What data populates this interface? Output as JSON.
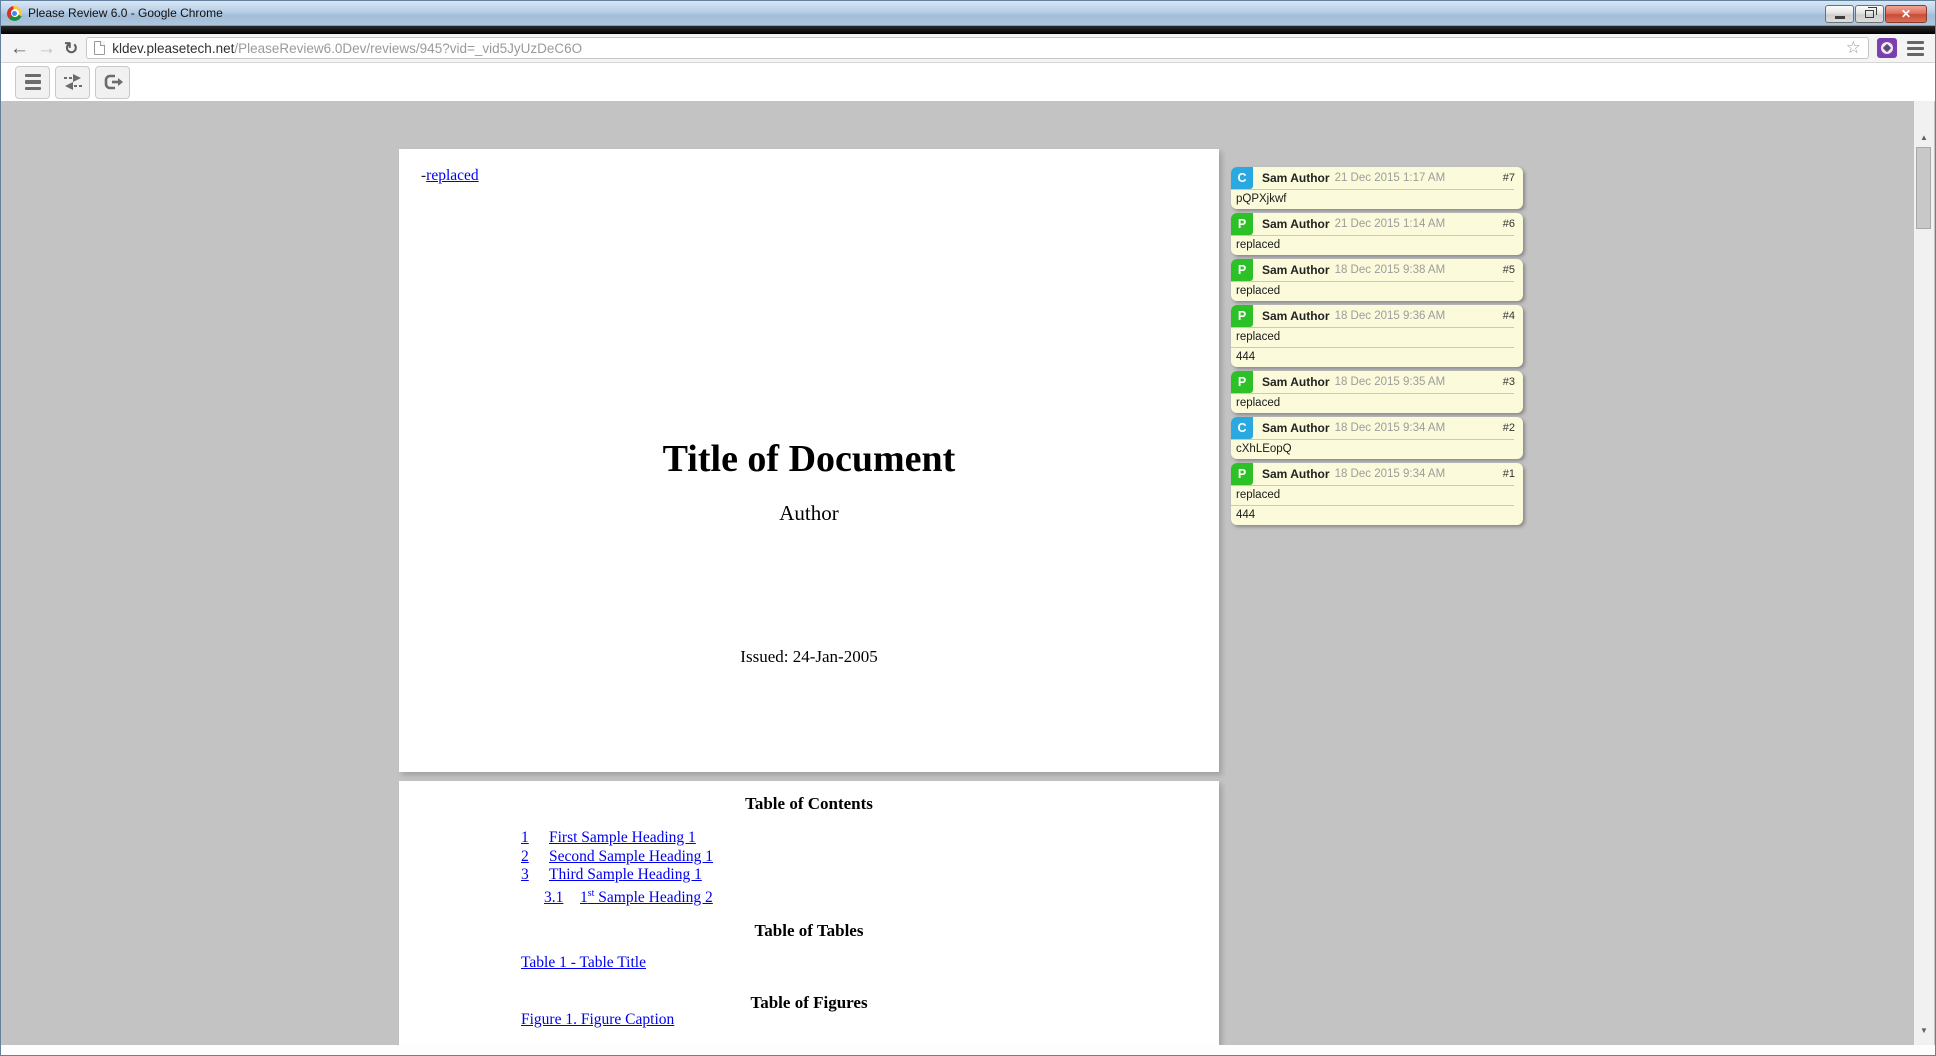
{
  "window": {
    "title": "Please Review 6.0 - Google Chrome",
    "close_glyph": "✕"
  },
  "browser": {
    "back_glyph": "←",
    "forward_glyph": "→",
    "reload_glyph": "↻",
    "star_glyph": "☆",
    "url_host": "kldev.pleasetech.net",
    "url_rest": "/PleaseReview6.0Dev/reviews/945?vid=_vid5JyUzDeC6O"
  },
  "scrollbar": {
    "up_glyph": "▲",
    "down_glyph": "▼"
  },
  "document": {
    "page1": {
      "change_prefix": "-",
      "change_link": "replaced",
      "title": "Title of Document",
      "author": "Author",
      "issued": "Issued: 24-Jan-2005"
    },
    "page2": {
      "toc_heading": "Table of Contents",
      "toc_entries": [
        {
          "num": "1",
          "label": "First Sample Heading 1",
          "sub": false
        },
        {
          "num": "2",
          "label": "Second Sample Heading 1",
          "sub": false
        },
        {
          "num": "3",
          "label": "Third Sample Heading 1",
          "sub": false
        },
        {
          "num": "3.1",
          "pre": "1",
          "sup": "st",
          "post": " Sample Heading 2",
          "sub": true
        }
      ],
      "tables_heading": "Table of Tables",
      "tables_entry": "Table 1 - Table Title",
      "figures_heading": "Table of Figures",
      "figures_entry": "Figure 1. Figure Caption"
    }
  },
  "comments": [
    {
      "type": "C",
      "author": "Sam Author",
      "time": "21 Dec 2015 1:17 AM",
      "num": "#7",
      "lines": [
        "pQPXjkwf"
      ]
    },
    {
      "type": "P",
      "author": "Sam Author",
      "time": "21 Dec 2015 1:14 AM",
      "num": "#6",
      "lines": [
        "replaced"
      ]
    },
    {
      "type": "P",
      "author": "Sam Author",
      "time": "18 Dec 2015 9:38 AM",
      "num": "#5",
      "lines": [
        "replaced"
      ]
    },
    {
      "type": "P",
      "author": "Sam Author",
      "time": "18 Dec 2015 9:36 AM",
      "num": "#4",
      "lines": [
        "replaced",
        "444"
      ]
    },
    {
      "type": "P",
      "author": "Sam Author",
      "time": "18 Dec 2015 9:35 AM",
      "num": "#3",
      "lines": [
        "replaced"
      ]
    },
    {
      "type": "C",
      "author": "Sam Author",
      "time": "18 Dec 2015 9:34 AM",
      "num": "#2",
      "lines": [
        "cXhLEopQ"
      ]
    },
    {
      "type": "P",
      "author": "Sam Author",
      "time": "18 Dec 2015 9:34 AM",
      "num": "#1",
      "lines": [
        "replaced",
        "444"
      ]
    }
  ],
  "colors": {
    "badge_c_blue": "#29a9e0",
    "badge_p_green": "#2bc127",
    "link_blue": "#0000ee",
    "card_bg": "#fbfbdb"
  }
}
